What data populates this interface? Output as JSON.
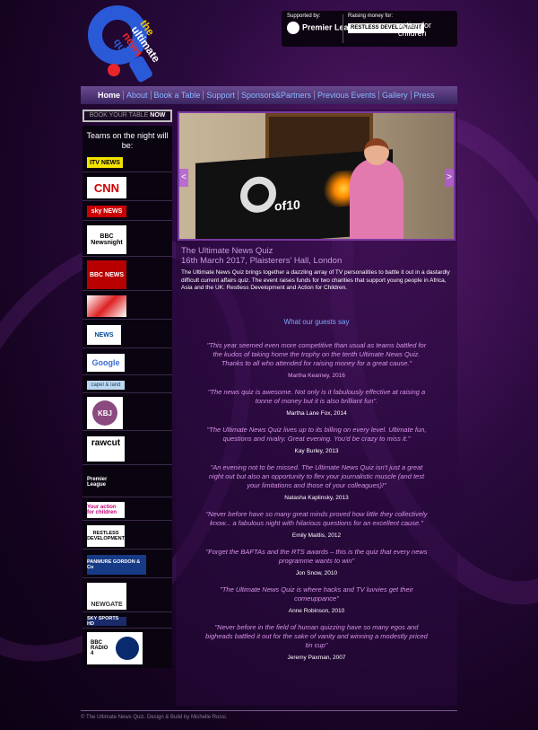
{
  "logo": {
    "line1": "the",
    "line2": "ultimate",
    "line3": "news",
    "line4": "quiz"
  },
  "sponsors": {
    "supported_label": "Supported by:",
    "supported_name": "Premier League",
    "raising_label": "Raising money for:",
    "charity1": "RESTLESS DEVELOPMENT",
    "charity2": "action for children"
  },
  "nav": {
    "items": [
      "Home",
      "About",
      "Book a Table",
      "Support",
      "Sponsors&Partners",
      "Previous Events",
      "Gallery",
      "Press"
    ]
  },
  "book": {
    "prefix": "BOOK YOUR TABLE",
    "now": "NOW"
  },
  "sidebar": {
    "heading": "Teams on the night will be:",
    "teams": [
      "ITV NEWS",
      "CNN",
      "sky NEWS",
      "BBC Newsnight",
      "BBC NEWS",
      "",
      "NEWS",
      "Google",
      "capel & land",
      "KBJ",
      "rawcut",
      "Premier League",
      "Your action for children",
      "RESTLESS DEVELOPMENT",
      "PANMURE GORDON & Co",
      "NEWGATE",
      "SKY SPORTS HD",
      "BBC RADIO 4"
    ]
  },
  "hero": {
    "prev": "<",
    "next": ">",
    "screen_text": "of10"
  },
  "main": {
    "title_line1": "The Ultimate News Quiz",
    "title_line2": "16th March 2017, Plaisterers' Hall, London",
    "intro": "The Ultimate News Quiz brings together a dazzling array of TV personalities to battle it out in a dastardly difficult current affairs quiz. The event raises funds for two charities that support young people in Africa, Asia and the UK: Restless Development and Action for Children.",
    "guests_heading": "What our guests say"
  },
  "quotes": [
    {
      "text": "\"This year seemed even more competitive than usual as teams battled for the kudos of taking home the trophy on the tenth Ultimate News Quiz. Thanks to all who attended for raising money for a great cause.\"",
      "author": "Martha Kearney, 2016"
    },
    {
      "text": "\"The news quiz is awesome. Not only is it fabulously effective at raising a tonne of money but it is also brilliant fun\".",
      "author": "Martha Lane Fox, 2014"
    },
    {
      "text": "\"The Ultimate News Quiz lives up to its billing on every level. Ultimate fun, questions and rivalry. Great evening. You'd be crazy to miss it.\"",
      "author": "Kay Burley, 2013"
    },
    {
      "text": "\"An evening not to be missed. The Ultimate News Quiz isn't just a great night out but also an opportunity to flex your journalistic muscle (and test your limitations and those of your colleagues)!\"",
      "author": "Natasha Kaplinsky, 2013"
    },
    {
      "text": "\"Never before have so many great minds proved how little they collectively know... a fabulous night with hilarious questions for an excellent cause.\"",
      "author": "Emily Maitlis, 2012"
    },
    {
      "text": "\"Forget the BAFTAs and the RTS awards – this is the quiz that every news programme wants to win\"",
      "author": "Jon Snow, 2010"
    },
    {
      "text": "\"The Ultimate News Quiz is where hacks and TV luvvies get their comeuppance\"",
      "author": "Anne Robinson, 2010"
    },
    {
      "text": "\"Never before in the field of human quizzing have so many egos and bigheads battled it out for the sake of vanity and winning a modestly priced tin cup\"",
      "author": "Jeremy Paxman, 2007"
    }
  ],
  "footer": {
    "text": "© The Ultimate News Quiz. Design & Build by Michelle Rossi."
  }
}
